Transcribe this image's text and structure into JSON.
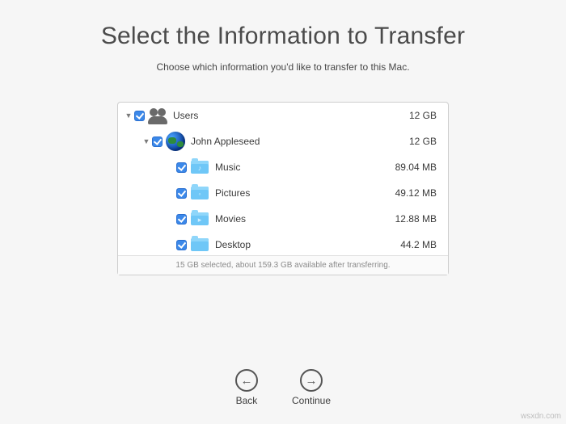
{
  "title": "Select the Information to Transfer",
  "subtitle": "Choose which information you'd like to transfer to this Mac.",
  "tree": {
    "users": {
      "label": "Users",
      "size": "12 GB"
    },
    "user": {
      "label": "John Appleseed",
      "size": "12 GB"
    },
    "folders": [
      {
        "label": "Music",
        "size": "89.04 MB",
        "glyph": "♪"
      },
      {
        "label": "Pictures",
        "size": "49.12 MB",
        "glyph": "◦"
      },
      {
        "label": "Movies",
        "size": "12.88 MB",
        "glyph": "▸"
      },
      {
        "label": "Desktop",
        "size": "44.2 MB",
        "glyph": ""
      }
    ]
  },
  "footer": "15 GB selected, about 159.3 GB available after transferring.",
  "nav": {
    "back": "Back",
    "continue": "Continue"
  },
  "watermark": "wsxdn.com"
}
